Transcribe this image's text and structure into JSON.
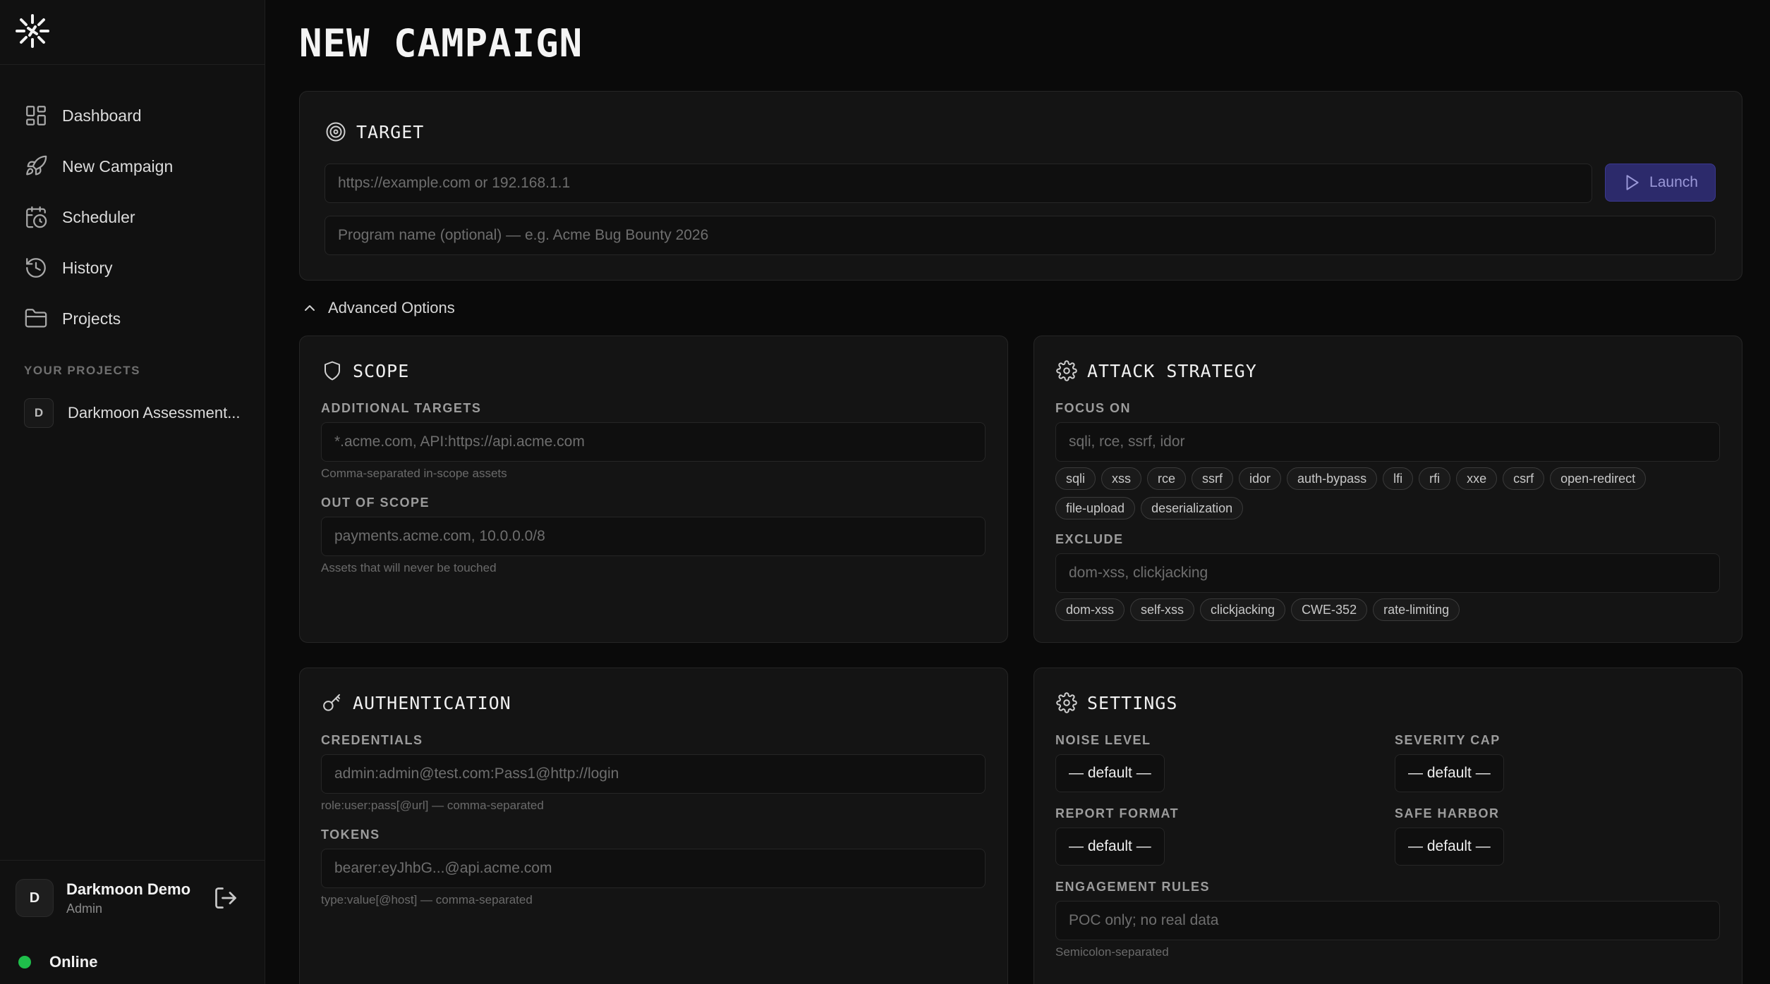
{
  "sidebar": {
    "nav": [
      {
        "label": "Dashboard",
        "icon": "dashboard-icon"
      },
      {
        "label": "New Campaign",
        "icon": "rocket-icon"
      },
      {
        "label": "Scheduler",
        "icon": "calendar-clock-icon"
      },
      {
        "label": "History",
        "icon": "history-icon"
      },
      {
        "label": "Projects",
        "icon": "folder-icon"
      }
    ],
    "section_label": "YOUR PROJECTS",
    "project": {
      "initial": "D",
      "name": "Darkmoon Assessment..."
    },
    "user": {
      "initial": "D",
      "name": "Darkmoon Demo",
      "role": "Admin"
    },
    "status": {
      "text": "Online",
      "color": "#1fbf4b"
    }
  },
  "page": {
    "title": "NEW CAMPAIGN"
  },
  "target": {
    "title": "TARGET",
    "url_placeholder": "https://example.com or 192.168.1.1",
    "program_placeholder": "Program name (optional) — e.g. Acme Bug Bounty 2026",
    "launch_label": "Launch"
  },
  "advanced_label": "Advanced Options",
  "scope": {
    "title": "SCOPE",
    "additional_label": "ADDITIONAL TARGETS",
    "additional_placeholder": "*.acme.com, API:https://api.acme.com",
    "additional_hint": "Comma-separated in-scope assets",
    "out_label": "OUT OF SCOPE",
    "out_placeholder": "payments.acme.com, 10.0.0.0/8",
    "out_hint": "Assets that will never be touched"
  },
  "strategy": {
    "title": "ATTACK STRATEGY",
    "focus_label": "FOCUS ON",
    "focus_placeholder": "sqli, rce, ssrf, idor",
    "focus_tags": [
      "sqli",
      "xss",
      "rce",
      "ssrf",
      "idor",
      "auth-bypass",
      "lfi",
      "rfi",
      "xxe",
      "csrf",
      "open-redirect",
      "file-upload",
      "deserialization"
    ],
    "exclude_label": "EXCLUDE",
    "exclude_placeholder": "dom-xss, clickjacking",
    "exclude_tags": [
      "dom-xss",
      "self-xss",
      "clickjacking",
      "CWE-352",
      "rate-limiting"
    ]
  },
  "auth": {
    "title": "AUTHENTICATION",
    "cred_label": "CREDENTIALS",
    "cred_placeholder": "admin:admin@test.com:Pass1@http://login",
    "cred_hint": "role:user:pass[@url] — comma-separated",
    "tokens_label": "TOKENS",
    "tokens_placeholder": "bearer:eyJhbG...@api.acme.com",
    "tokens_hint": "type:value[@host] — comma-separated"
  },
  "settings": {
    "title": "SETTINGS",
    "noise_label": "NOISE LEVEL",
    "noise_value": "— default —",
    "severity_label": "SEVERITY CAP",
    "severity_value": "— default —",
    "report_label": "REPORT FORMAT",
    "report_value": "— default —",
    "harbor_label": "SAFE HARBOR",
    "harbor_value": "— default —",
    "rules_label": "ENGAGEMENT RULES",
    "rules_placeholder": "POC only; no real data",
    "rules_hint": "Semicolon-separated"
  }
}
